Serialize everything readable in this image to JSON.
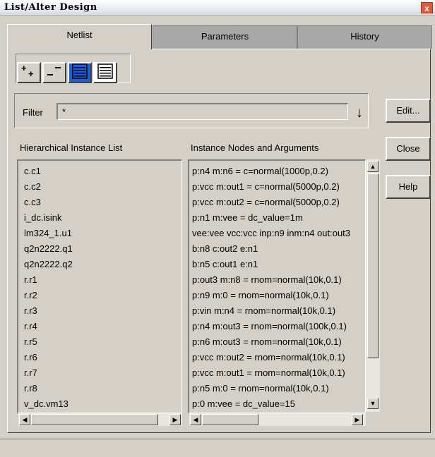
{
  "window": {
    "title": "List/Alter Design",
    "close_glyph": "x"
  },
  "tabs": [
    {
      "label": "Netlist",
      "selected": true
    },
    {
      "label": "Parameters",
      "selected": false
    },
    {
      "label": "History",
      "selected": false
    }
  ],
  "toolbar": {
    "add_label": "+",
    "remove_label": "−",
    "icons": [
      "add-icon",
      "remove-icon",
      "list-blue-icon",
      "list-icon"
    ]
  },
  "filter": {
    "label": "Filter",
    "value": "*",
    "go_glyph": "↓"
  },
  "buttons": {
    "edit": "Edit...",
    "close": "Close",
    "help": "Help"
  },
  "hier_list": {
    "header": "Hierarchical Instance List",
    "items": [
      "c.c1",
      "c.c2",
      "c.c3",
      "i_dc.isink",
      "lm324_1.u1",
      "q2n2222.q1",
      "q2n2222.q2",
      "r.r1",
      "r.r2",
      "r.r3",
      "r.r4",
      "r.r5",
      "r.r6",
      "r.r7",
      "r.r8",
      "v_dc.vm13"
    ]
  },
  "nodes_list": {
    "header": "Instance Nodes and Arguments",
    "items": [
      "p:n4 m:n6 = c=normal(1000p,0.2)",
      "p:vcc m:out1 = c=normal(5000p,0.2)",
      "p:vcc m:out2 = c=normal(5000p,0.2)",
      "p:n1 m:vee = dc_value=1m",
      "vee:vee vcc:vcc inp:n9 inm:n4 out:out3",
      "b:n8 c:out2 e:n1",
      "b:n5 c:out1 e:n1",
      "p:out3 m:n8 = rnom=normal(10k,0.1)",
      "p:n9 m:0 = rnom=normal(10k,0.1)",
      "p:vin m:n4 = rnom=normal(10k,0.1)",
      "p:n4 m:out3 = rnom=normal(100k,0.1)",
      "p:n6 m:out3 = rnom=normal(10k,0.1)",
      "p:vcc m:out2 = rnom=normal(10k,0.1)",
      "p:vcc m:out1 = rnom=normal(10k,0.1)",
      "p:n5 m:0 = rnom=normal(10k,0.1)",
      "p:0 m:vee = dc_value=15"
    ]
  },
  "colors": {
    "face": "#d4d0c8",
    "tab_inactive": "#a8a8a8",
    "accent_blue": "#1f5fd6"
  }
}
